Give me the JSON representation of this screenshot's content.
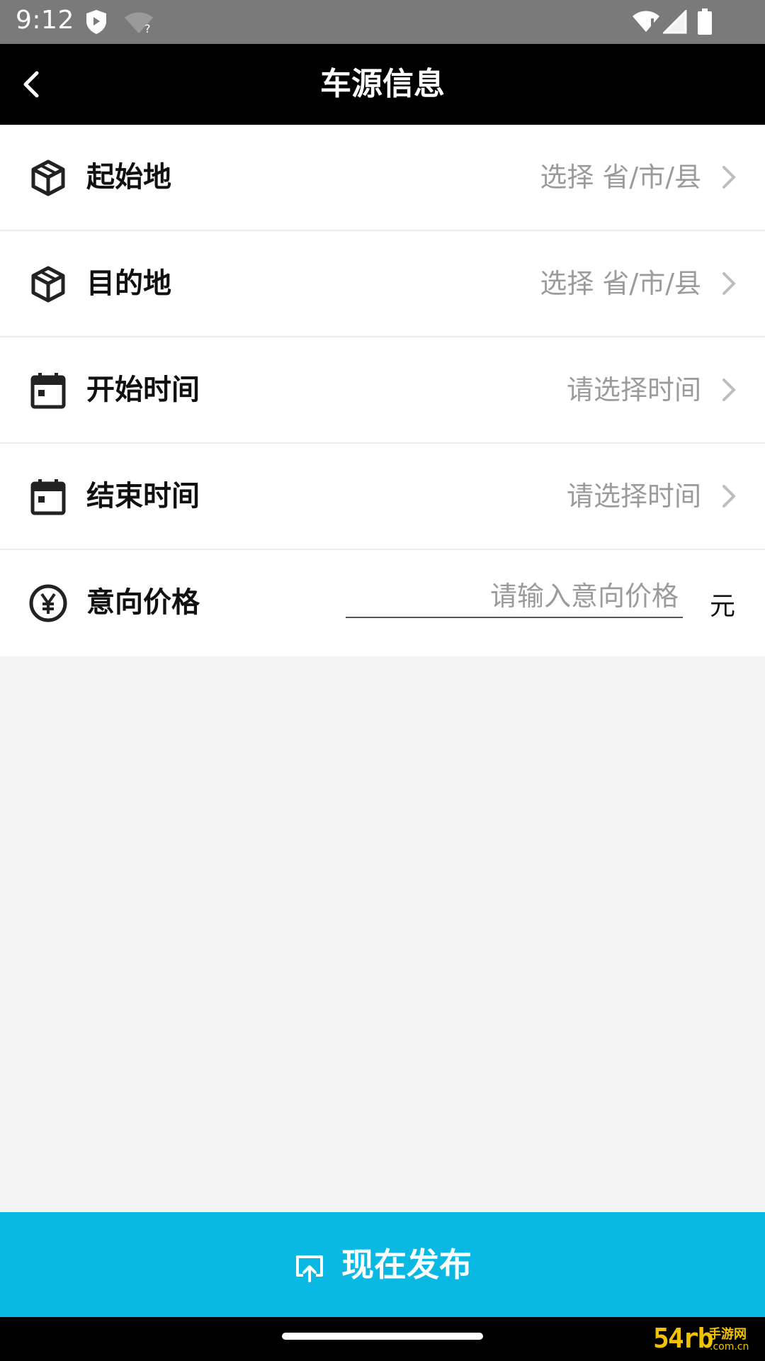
{
  "status_bar": {
    "time": "9:12",
    "icons": [
      "shield-icon",
      "wifi-unknown-icon",
      "wifi-alert-icon",
      "signal-icon",
      "battery-icon"
    ]
  },
  "app_bar": {
    "title": "车源信息",
    "back_icon": "back-arrow-icon"
  },
  "form": {
    "origin": {
      "label": "起始地",
      "value": "选择 省/市/县",
      "icon": "cube-icon"
    },
    "destination": {
      "label": "目的地",
      "value": "选择 省/市/县",
      "icon": "cube-icon"
    },
    "start_time": {
      "label": "开始时间",
      "value": "请选择时间",
      "icon": "calendar-icon"
    },
    "end_time": {
      "label": "结束时间",
      "value": "请选择时间",
      "icon": "calendar-icon"
    },
    "price": {
      "label": "意向价格",
      "placeholder": "请输入意向价格",
      "unit": "元",
      "icon": "yen-icon"
    }
  },
  "publish_button": {
    "label": "现在发布",
    "icon": "upload-icon"
  },
  "watermark": {
    "big": "54rb",
    "line1": "手游网",
    "line2": ".com.cn"
  },
  "colors": {
    "accent": "#09b8e3",
    "app_bar": "#000000",
    "placeholder": "#9b9b9b"
  }
}
